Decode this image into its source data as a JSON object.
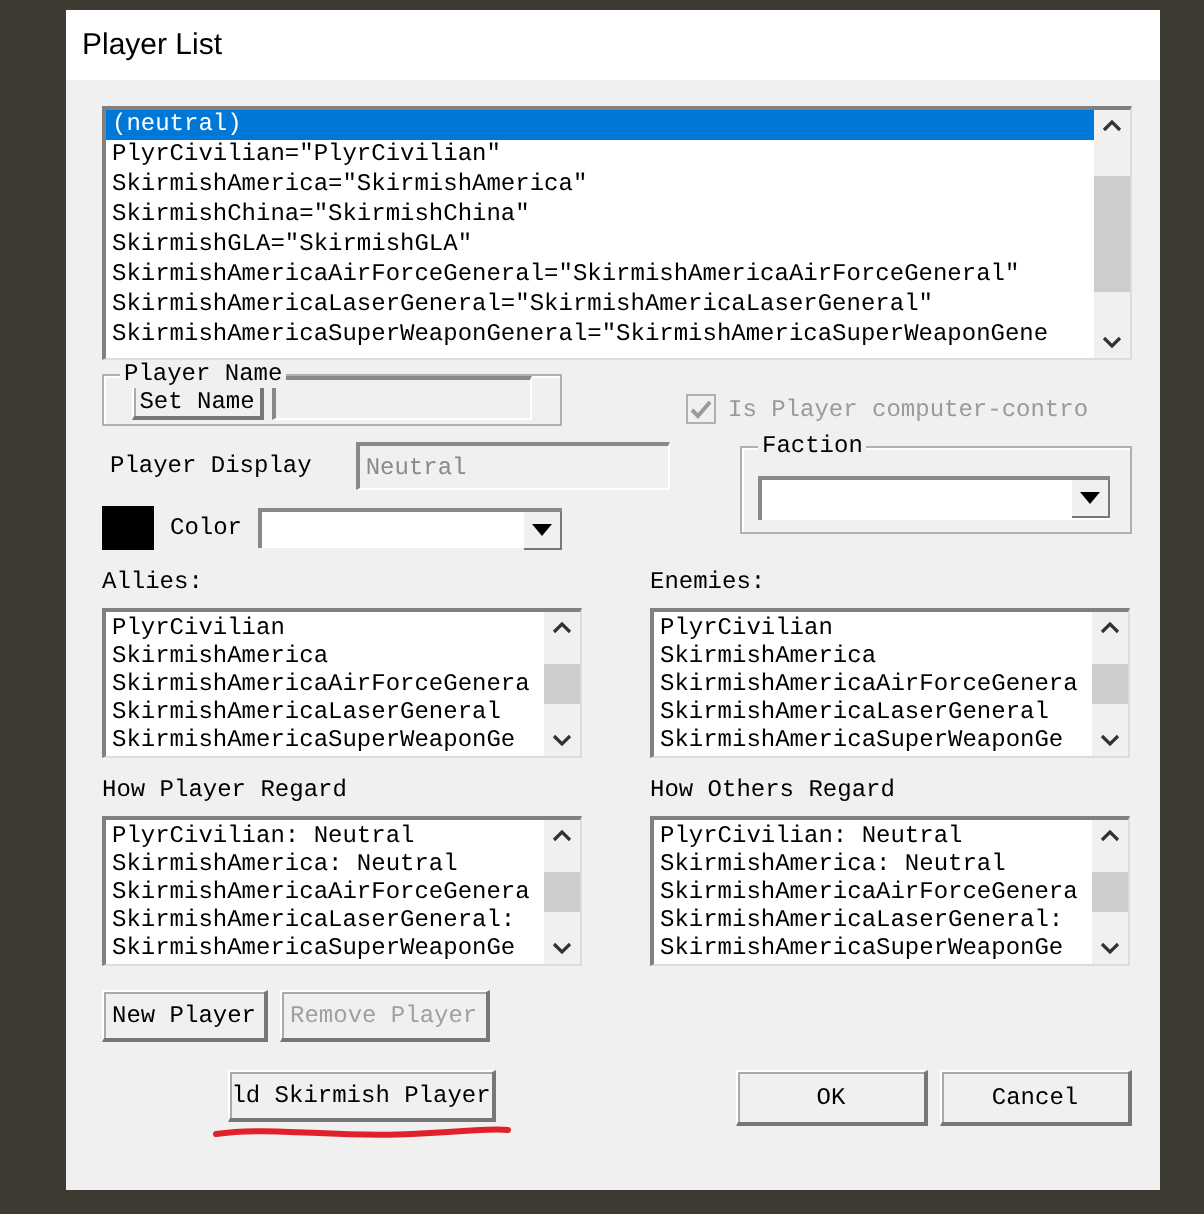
{
  "window": {
    "title": "Player List"
  },
  "player_list": {
    "items": [
      {
        "label": "(neutral)",
        "selected": true
      },
      {
        "label": "PlyrCivilian=\"PlyrCivilian\"",
        "selected": false
      },
      {
        "label": "SkirmishAmerica=\"SkirmishAmerica\"",
        "selected": false
      },
      {
        "label": "SkirmishChina=\"SkirmishChina\"",
        "selected": false
      },
      {
        "label": "SkirmishGLA=\"SkirmishGLA\"",
        "selected": false
      },
      {
        "label": "SkirmishAmericaAirForceGeneral=\"SkirmishAmericaAirForceGeneral\"",
        "selected": false
      },
      {
        "label": "SkirmishAmericaLaserGeneral=\"SkirmishAmericaLaserGeneral\"",
        "selected": false
      },
      {
        "label": "SkirmishAmericaSuperWeaponGeneral=\"SkirmishAmericaSuperWeaponGene",
        "selected": false
      }
    ]
  },
  "player_name": {
    "legend": "Player Name",
    "button": "Set Name"
  },
  "computer_controlled": {
    "label": "Is Player computer-contro",
    "checked": true,
    "disabled": true
  },
  "player_display": {
    "label": "Player Display",
    "value": "Neutral",
    "disabled": true
  },
  "faction": {
    "legend": "Faction"
  },
  "color": {
    "label": "Color"
  },
  "allies": {
    "label": "Allies:",
    "items": [
      "PlyrCivilian",
      "SkirmishAmerica",
      "SkirmishAmericaAirForceGenera",
      "SkirmishAmericaLaserGeneral",
      "SkirmishAmericaSuperWeaponGe"
    ]
  },
  "enemies": {
    "label": "Enemies:",
    "items": [
      "PlyrCivilian",
      "SkirmishAmerica",
      "SkirmishAmericaAirForceGenera",
      "SkirmishAmericaLaserGeneral",
      "SkirmishAmericaSuperWeaponGe"
    ]
  },
  "how_player_regard": {
    "label": "How Player Regard",
    "items": [
      "PlyrCivilian: Neutral",
      "SkirmishAmerica: Neutral",
      "SkirmishAmericaAirForceGenera",
      "SkirmishAmericaLaserGeneral:",
      "SkirmishAmericaSuperWeaponGe"
    ]
  },
  "how_others_regard": {
    "label": "How Others Regard",
    "items": [
      "PlyrCivilian: Neutral",
      "SkirmishAmerica: Neutral",
      "SkirmishAmericaAirForceGenera",
      "SkirmishAmericaLaserGeneral:",
      "SkirmishAmericaSuperWeaponGe"
    ]
  },
  "player_buttons": [
    {
      "label": "New Player",
      "disabled": false
    },
    {
      "label": "Remove Player",
      "disabled": true
    }
  ],
  "add_skirmish_button": {
    "label": "ld Skirmish Player",
    "underlined": true
  },
  "dialog_buttons": [
    {
      "label": "OK"
    },
    {
      "label": "Cancel"
    }
  ]
}
